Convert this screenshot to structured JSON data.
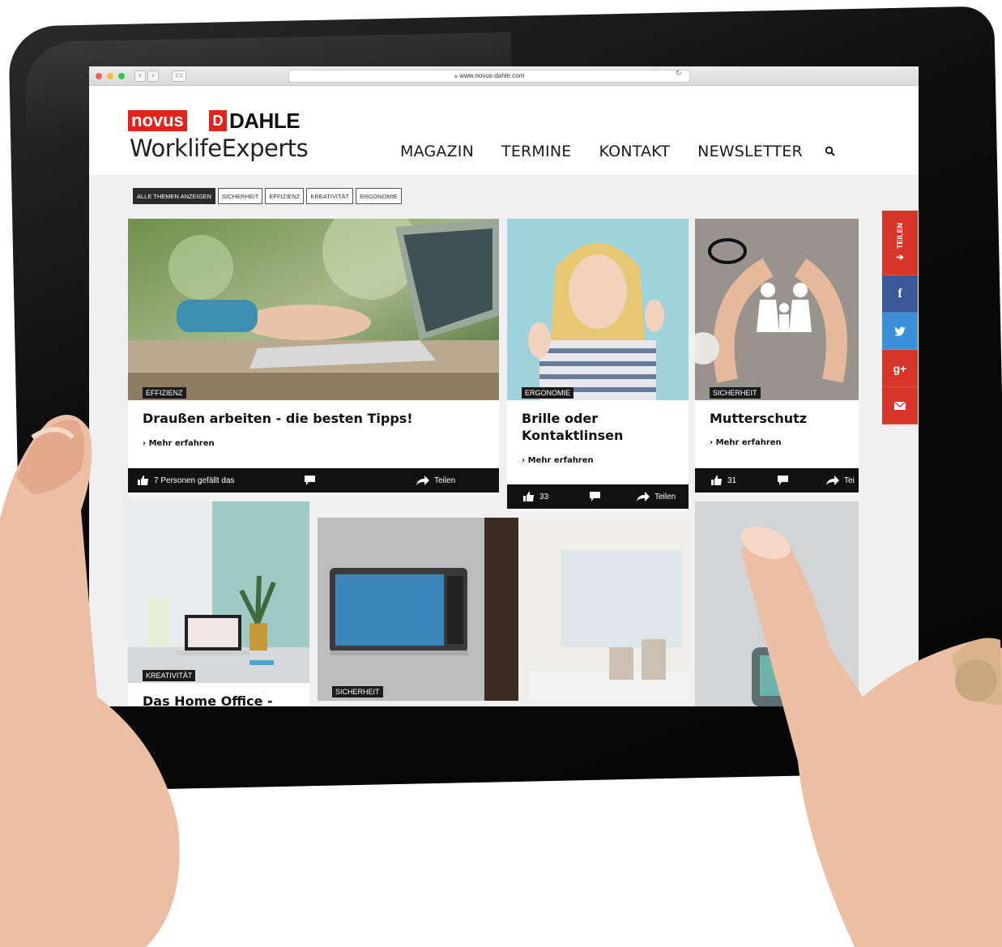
{
  "browser": {
    "url": "www.novus-dahle.com"
  },
  "header": {
    "logo_novus": "novus",
    "logo_dahle": "DAHLE",
    "tagline": "WorklifeExperts",
    "nav": [
      "MAGAZIN",
      "TERMINE",
      "KONTAKT",
      "NEWSLETTER"
    ]
  },
  "filters": [
    "ALLE THEMEN ANZEIGEN",
    "SICHERHEIT",
    "EFFIZIENZ",
    "KREATIVITÄT",
    "ERGONOMIE"
  ],
  "cards": [
    {
      "tag": "EFFIZIENZ",
      "title": "Draußen arbeiten - die besten Tipps!",
      "more": "Mehr erfahren",
      "likes": "7 Personen gefällt das",
      "share": "Teilen"
    },
    {
      "tag": "ERGONOMIE",
      "title_line1": "Brille oder",
      "title_line2": "Kontaktlinsen",
      "more": "Mehr erfahren",
      "likes": "33",
      "share": "Teilen"
    },
    {
      "tag": "SICHERHEIT",
      "title": "Mutterschutz",
      "more": "Mehr erfahren",
      "likes": "31",
      "share": "Tei"
    },
    {
      "tag": "KREATIVITÄT",
      "title": "Das Home Office -"
    },
    {
      "tag": "SICHERHEIT"
    }
  ],
  "share_bar": {
    "label": "TEILEN",
    "icons": [
      "facebook-icon",
      "twitter-icon",
      "google-plus-icon",
      "mail-icon"
    ]
  },
  "colors": {
    "brand_red": "#e2231a",
    "dark": "#111111",
    "facebook": "#3b5998",
    "twitter": "#3a8fd6",
    "google_plus": "#d73527",
    "mail": "#d73527"
  }
}
